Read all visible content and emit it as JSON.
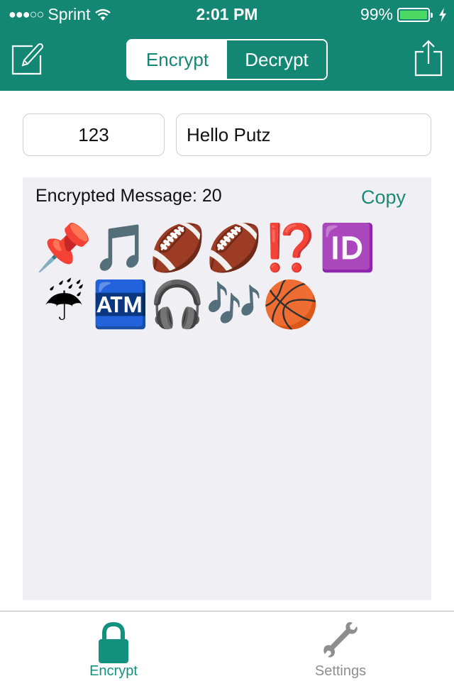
{
  "status_bar": {
    "signal": "●●●○○",
    "carrier": "Sprint",
    "time": "2:01 PM",
    "battery_percent_text": "99%",
    "battery_level": 0.99,
    "battery_color": "#4cd964"
  },
  "nav": {
    "compose_icon": "compose-icon",
    "share_icon": "share-icon",
    "segments": [
      {
        "label": "Encrypt",
        "selected": true
      },
      {
        "label": "Decrypt",
        "selected": false
      }
    ]
  },
  "inputs": {
    "key_value": "123",
    "message_value": "Hello Putz"
  },
  "output": {
    "label": "Encrypted Message: 20",
    "copy_label": "Copy",
    "emojis": [
      {
        "char": "📌",
        "name": "pushpin"
      },
      {
        "char": "🎵",
        "name": "musical-note"
      },
      {
        "char": "🏈",
        "name": "american-football"
      },
      {
        "char": "🏈",
        "name": "american-football"
      },
      {
        "char": "⁉️",
        "name": "exclamation-question-mark"
      },
      {
        "char": "🆔",
        "name": "id-button"
      },
      {
        "char": "☔",
        "name": "umbrella-with-rain"
      },
      {
        "char": "🏧",
        "name": "atm-sign"
      },
      {
        "char": "🎧",
        "name": "earphone"
      },
      {
        "char": "🎶",
        "name": "musical-notes"
      },
      {
        "char": "🏀",
        "name": "basketball"
      }
    ]
  },
  "tabbar": {
    "tabs": [
      {
        "label": "Encrypt",
        "icon": "lock-icon",
        "active": true
      },
      {
        "label": "Settings",
        "icon": "wrench-icon",
        "active": false
      }
    ]
  },
  "colors": {
    "brand": "#148774",
    "accent": "#13917f",
    "inactive": "#8e8e8e",
    "panel": "#efeff4"
  }
}
